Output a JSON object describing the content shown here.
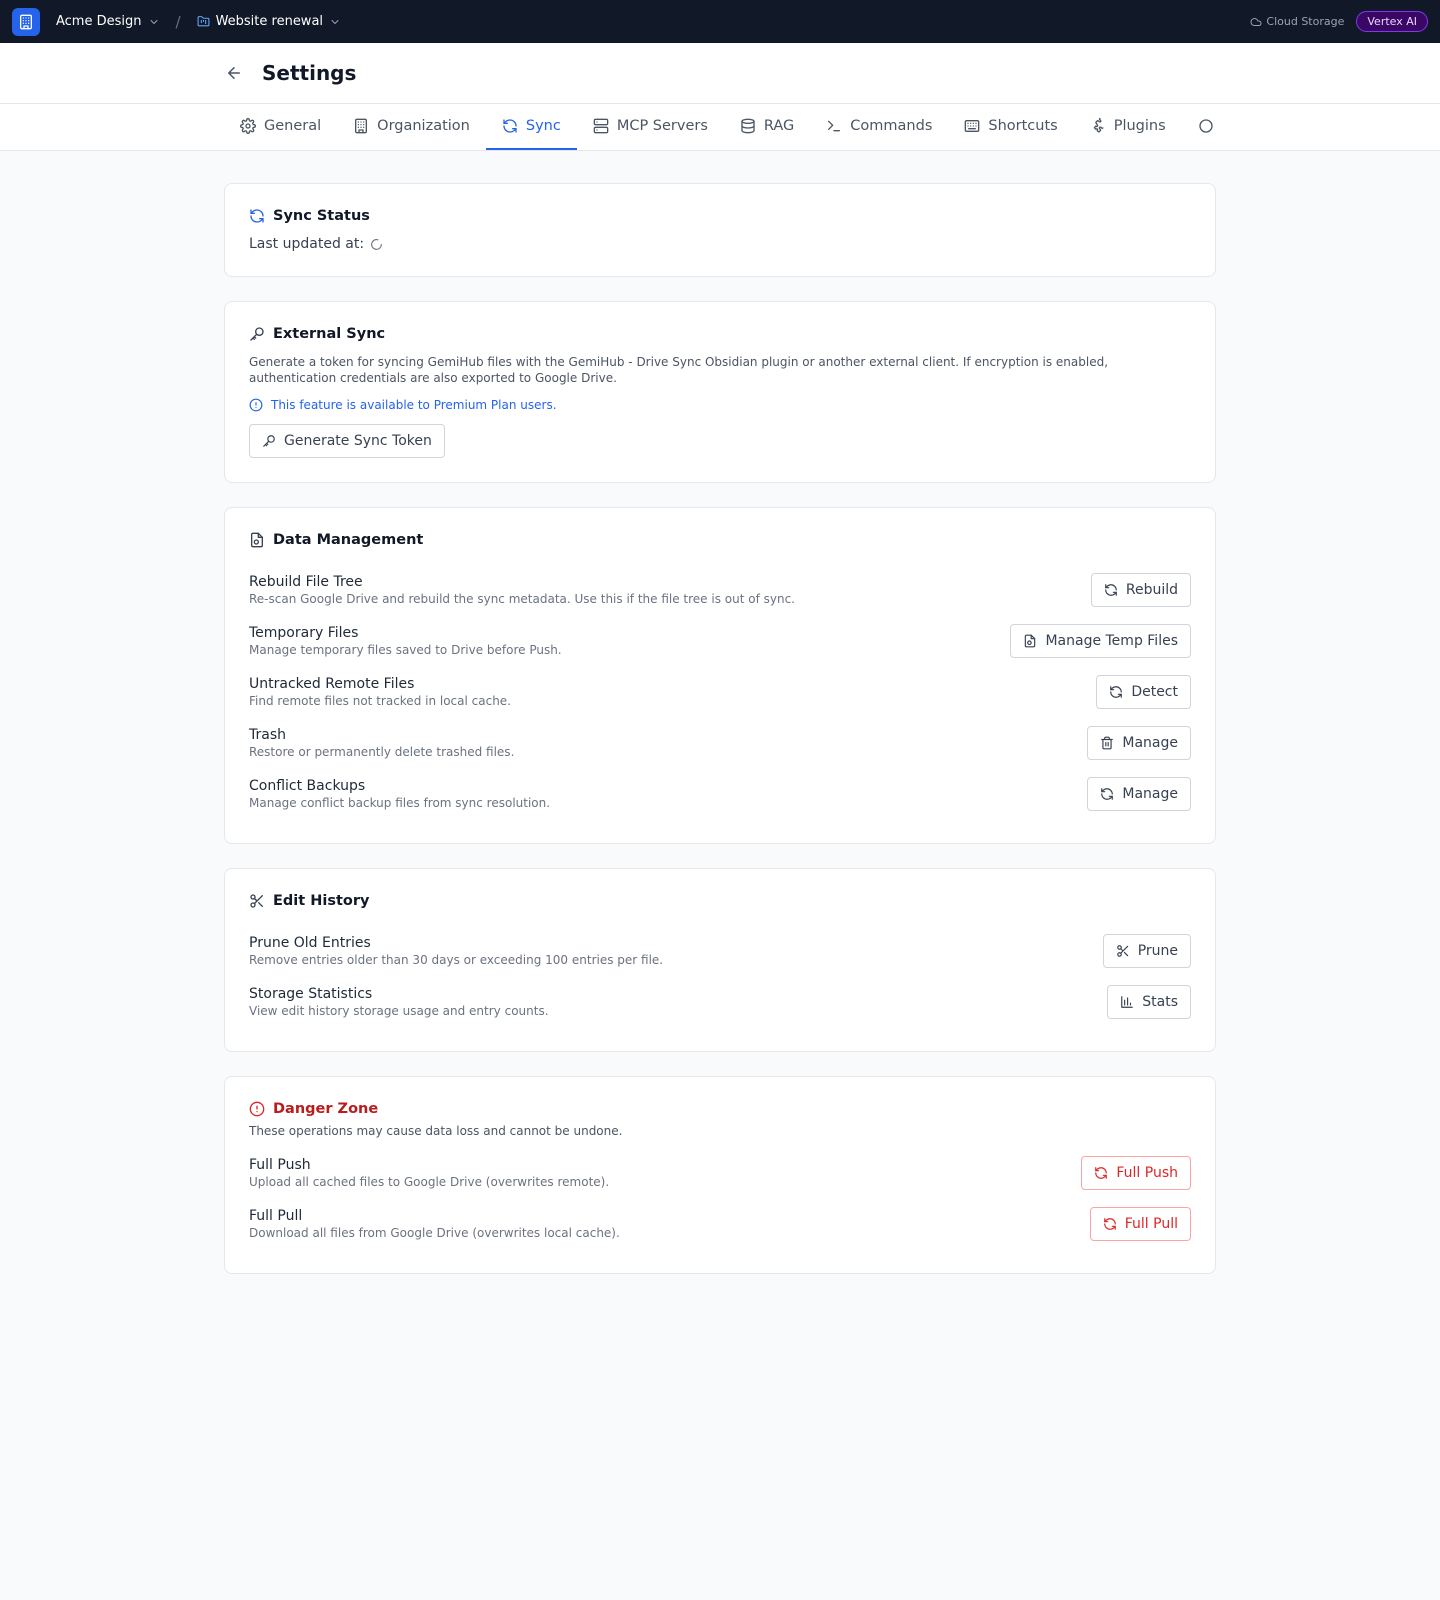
{
  "topbar": {
    "org_name": "Acme Design",
    "separator": "/",
    "project_name": "Website renewal",
    "storage_label": "Cloud Storage",
    "ai_badge": "Vertex AI"
  },
  "header": {
    "title": "Settings"
  },
  "tabs": [
    {
      "label": "General",
      "icon": "gear-icon",
      "active": false
    },
    {
      "label": "Organization",
      "icon": "building-icon",
      "active": false
    },
    {
      "label": "Sync",
      "icon": "sync-icon",
      "active": true
    },
    {
      "label": "MCP Servers",
      "icon": "server-icon",
      "active": false
    },
    {
      "label": "RAG",
      "icon": "database-icon",
      "active": false
    },
    {
      "label": "Commands",
      "icon": "terminal-icon",
      "active": false
    },
    {
      "label": "Shortcuts",
      "icon": "keyboard-icon",
      "active": false
    },
    {
      "label": "Plugins",
      "icon": "puzzle-icon",
      "active": false
    }
  ],
  "sync_status": {
    "title": "Sync Status",
    "last_updated_label": "Last updated at:"
  },
  "external_sync": {
    "title": "External Sync",
    "description": "Generate a token for syncing GemiHub files with the GemiHub - Drive Sync Obsidian plugin or another external client. If encryption is enabled, authentication credentials are also exported to Google Drive.",
    "premium_note": "This feature is available to Premium Plan users.",
    "button_label": "Generate Sync Token"
  },
  "data_management": {
    "title": "Data Management",
    "rows": [
      {
        "label": "Rebuild File Tree",
        "description": "Re-scan Google Drive and rebuild the sync metadata. Use this if the file tree is out of sync.",
        "button": "Rebuild",
        "icon": "sync-icon"
      },
      {
        "label": "Temporary Files",
        "description": "Manage temporary files saved to Drive before Push.",
        "button": "Manage Temp Files",
        "icon": "file-sync-icon"
      },
      {
        "label": "Untracked Remote Files",
        "description": "Find remote files not tracked in local cache.",
        "button": "Detect",
        "icon": "sync-icon"
      },
      {
        "label": "Trash",
        "description": "Restore or permanently delete trashed files.",
        "button": "Manage",
        "icon": "trash-icon"
      },
      {
        "label": "Conflict Backups",
        "description": "Manage conflict backup files from sync resolution.",
        "button": "Manage",
        "icon": "sync-icon"
      }
    ]
  },
  "edit_history": {
    "title": "Edit History",
    "rows": [
      {
        "label": "Prune Old Entries",
        "description": "Remove entries older than 30 days or exceeding 100 entries per file.",
        "button": "Prune",
        "icon": "scissors-icon"
      },
      {
        "label": "Storage Statistics",
        "description": "View edit history storage usage and entry counts.",
        "button": "Stats",
        "icon": "bar-chart-icon"
      }
    ]
  },
  "danger_zone": {
    "title": "Danger Zone",
    "description": "These operations may cause data loss and cannot be undone.",
    "rows": [
      {
        "label": "Full Push",
        "description": "Upload all cached files to Google Drive (overwrites remote).",
        "button": "Full Push",
        "icon": "sync-icon"
      },
      {
        "label": "Full Pull",
        "description": "Download all files from Google Drive (overwrites local cache).",
        "button": "Full Pull",
        "icon": "sync-icon"
      }
    ]
  },
  "colors": {
    "topbar_bg": "#111827",
    "accent": "#2563eb",
    "danger": "#dc2626",
    "badge_bg": "#3b0764"
  }
}
